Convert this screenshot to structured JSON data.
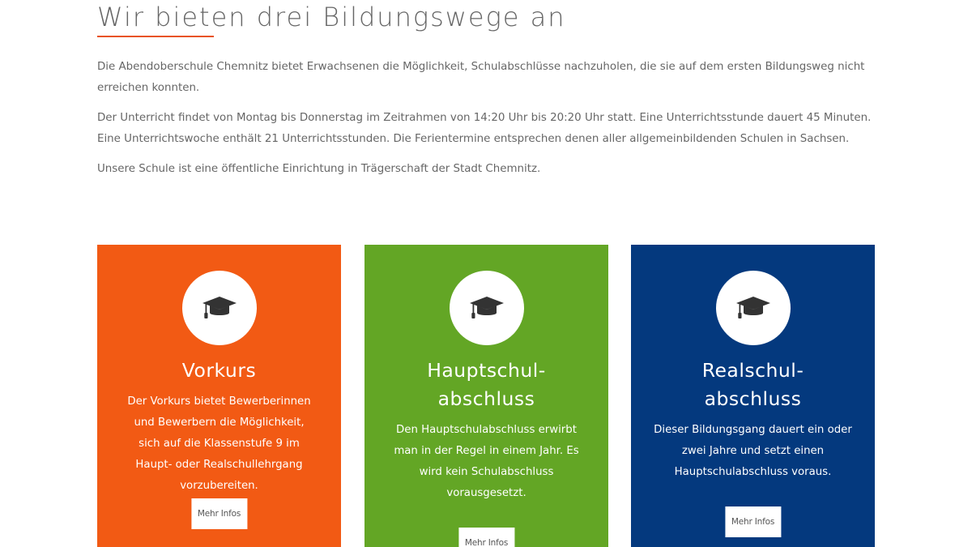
{
  "page": {
    "title": "Wir bieten drei Bildungswege an",
    "accent_color": "#e8531e"
  },
  "intro": {
    "paragraphs": [
      "Die Abendoberschule Chemnitz bietet Erwachsenen die Möglichkeit, Schulabschlüsse nachzuholen, die sie auf dem ersten Bildungsweg nicht erreichen konnten.",
      "Der Unterricht findet von Montag bis Donnerstag im Zeitrahmen von 14:20 Uhr bis 20:20 Uhr statt. Eine Unterrichtsstunde dauert 45 Minuten. Eine Unterrichtswoche enthält 21 Unterrichtsstunden. Die Ferientermine entsprechen denen aller allgemeinbildenden Schulen in Sachsen.",
      "Unsere Schule ist eine öffentliche Einrichtung in Trägerschaft der Stadt Chemnitz."
    ]
  },
  "cards": [
    {
      "title": "Vorkurs",
      "text": "Der Vorkurs bietet Bewerberinnen und Bewerbern die Möglichkeit, sich auf die Klassenstufe 9 im Haupt- oder Realschullehrgang vorzubereiten.",
      "button": "Mehr Infos",
      "color": "#f25a14",
      "icon": "graduation-cap-icon"
    },
    {
      "title": "Hauptschul-\nabschluss",
      "text": "Den Hauptschulabschluss erwirbt man in der Regel in einem Jahr. Es wird kein Schulabschluss vorausgesetzt.",
      "button": "Mehr Infos",
      "color": "#63a625",
      "icon": "graduation-cap-icon"
    },
    {
      "title": "Realschul-\nabschluss",
      "text": "Dieser Bildungsgang dauert ein oder zwei Jahre und setzt einen Hauptschulabschluss voraus.",
      "button": "Mehr Infos",
      "color": "#04397e",
      "icon": "graduation-cap-icon"
    }
  ]
}
